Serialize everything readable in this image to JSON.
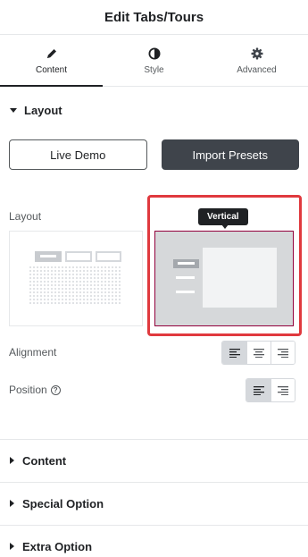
{
  "header": {
    "title": "Edit Tabs/Tours"
  },
  "tabs": [
    {
      "label": "Content",
      "icon": "pencil-icon",
      "active": true
    },
    {
      "label": "Style",
      "icon": "half-circle-icon",
      "active": false
    },
    {
      "label": "Advanced",
      "icon": "gear-icon",
      "active": false
    }
  ],
  "layout_section": {
    "title": "Layout",
    "live_demo_label": "Live Demo",
    "import_presets_label": "Import Presets",
    "layout_label": "Layout",
    "tooltip": "Vertical",
    "presets": [
      {
        "name": "horizontal-preset",
        "selected": false
      },
      {
        "name": "vertical-preset",
        "selected": true
      }
    ],
    "alignment_label": "Alignment",
    "alignment_options": [
      "align-left-icon",
      "align-center-icon",
      "align-right-icon"
    ],
    "alignment_selected": "align-left-icon",
    "position_label": "Position",
    "position_help": "?",
    "position_options": [
      "align-left-icon",
      "align-right-icon"
    ],
    "position_selected": "align-left-icon"
  },
  "collapsed_sections": [
    {
      "title": "Content"
    },
    {
      "title": "Special Option"
    },
    {
      "title": "Extra Option"
    }
  ],
  "colors": {
    "accent": "#93003c",
    "highlight": "#e0393e",
    "dark_button": "#3f444b"
  }
}
